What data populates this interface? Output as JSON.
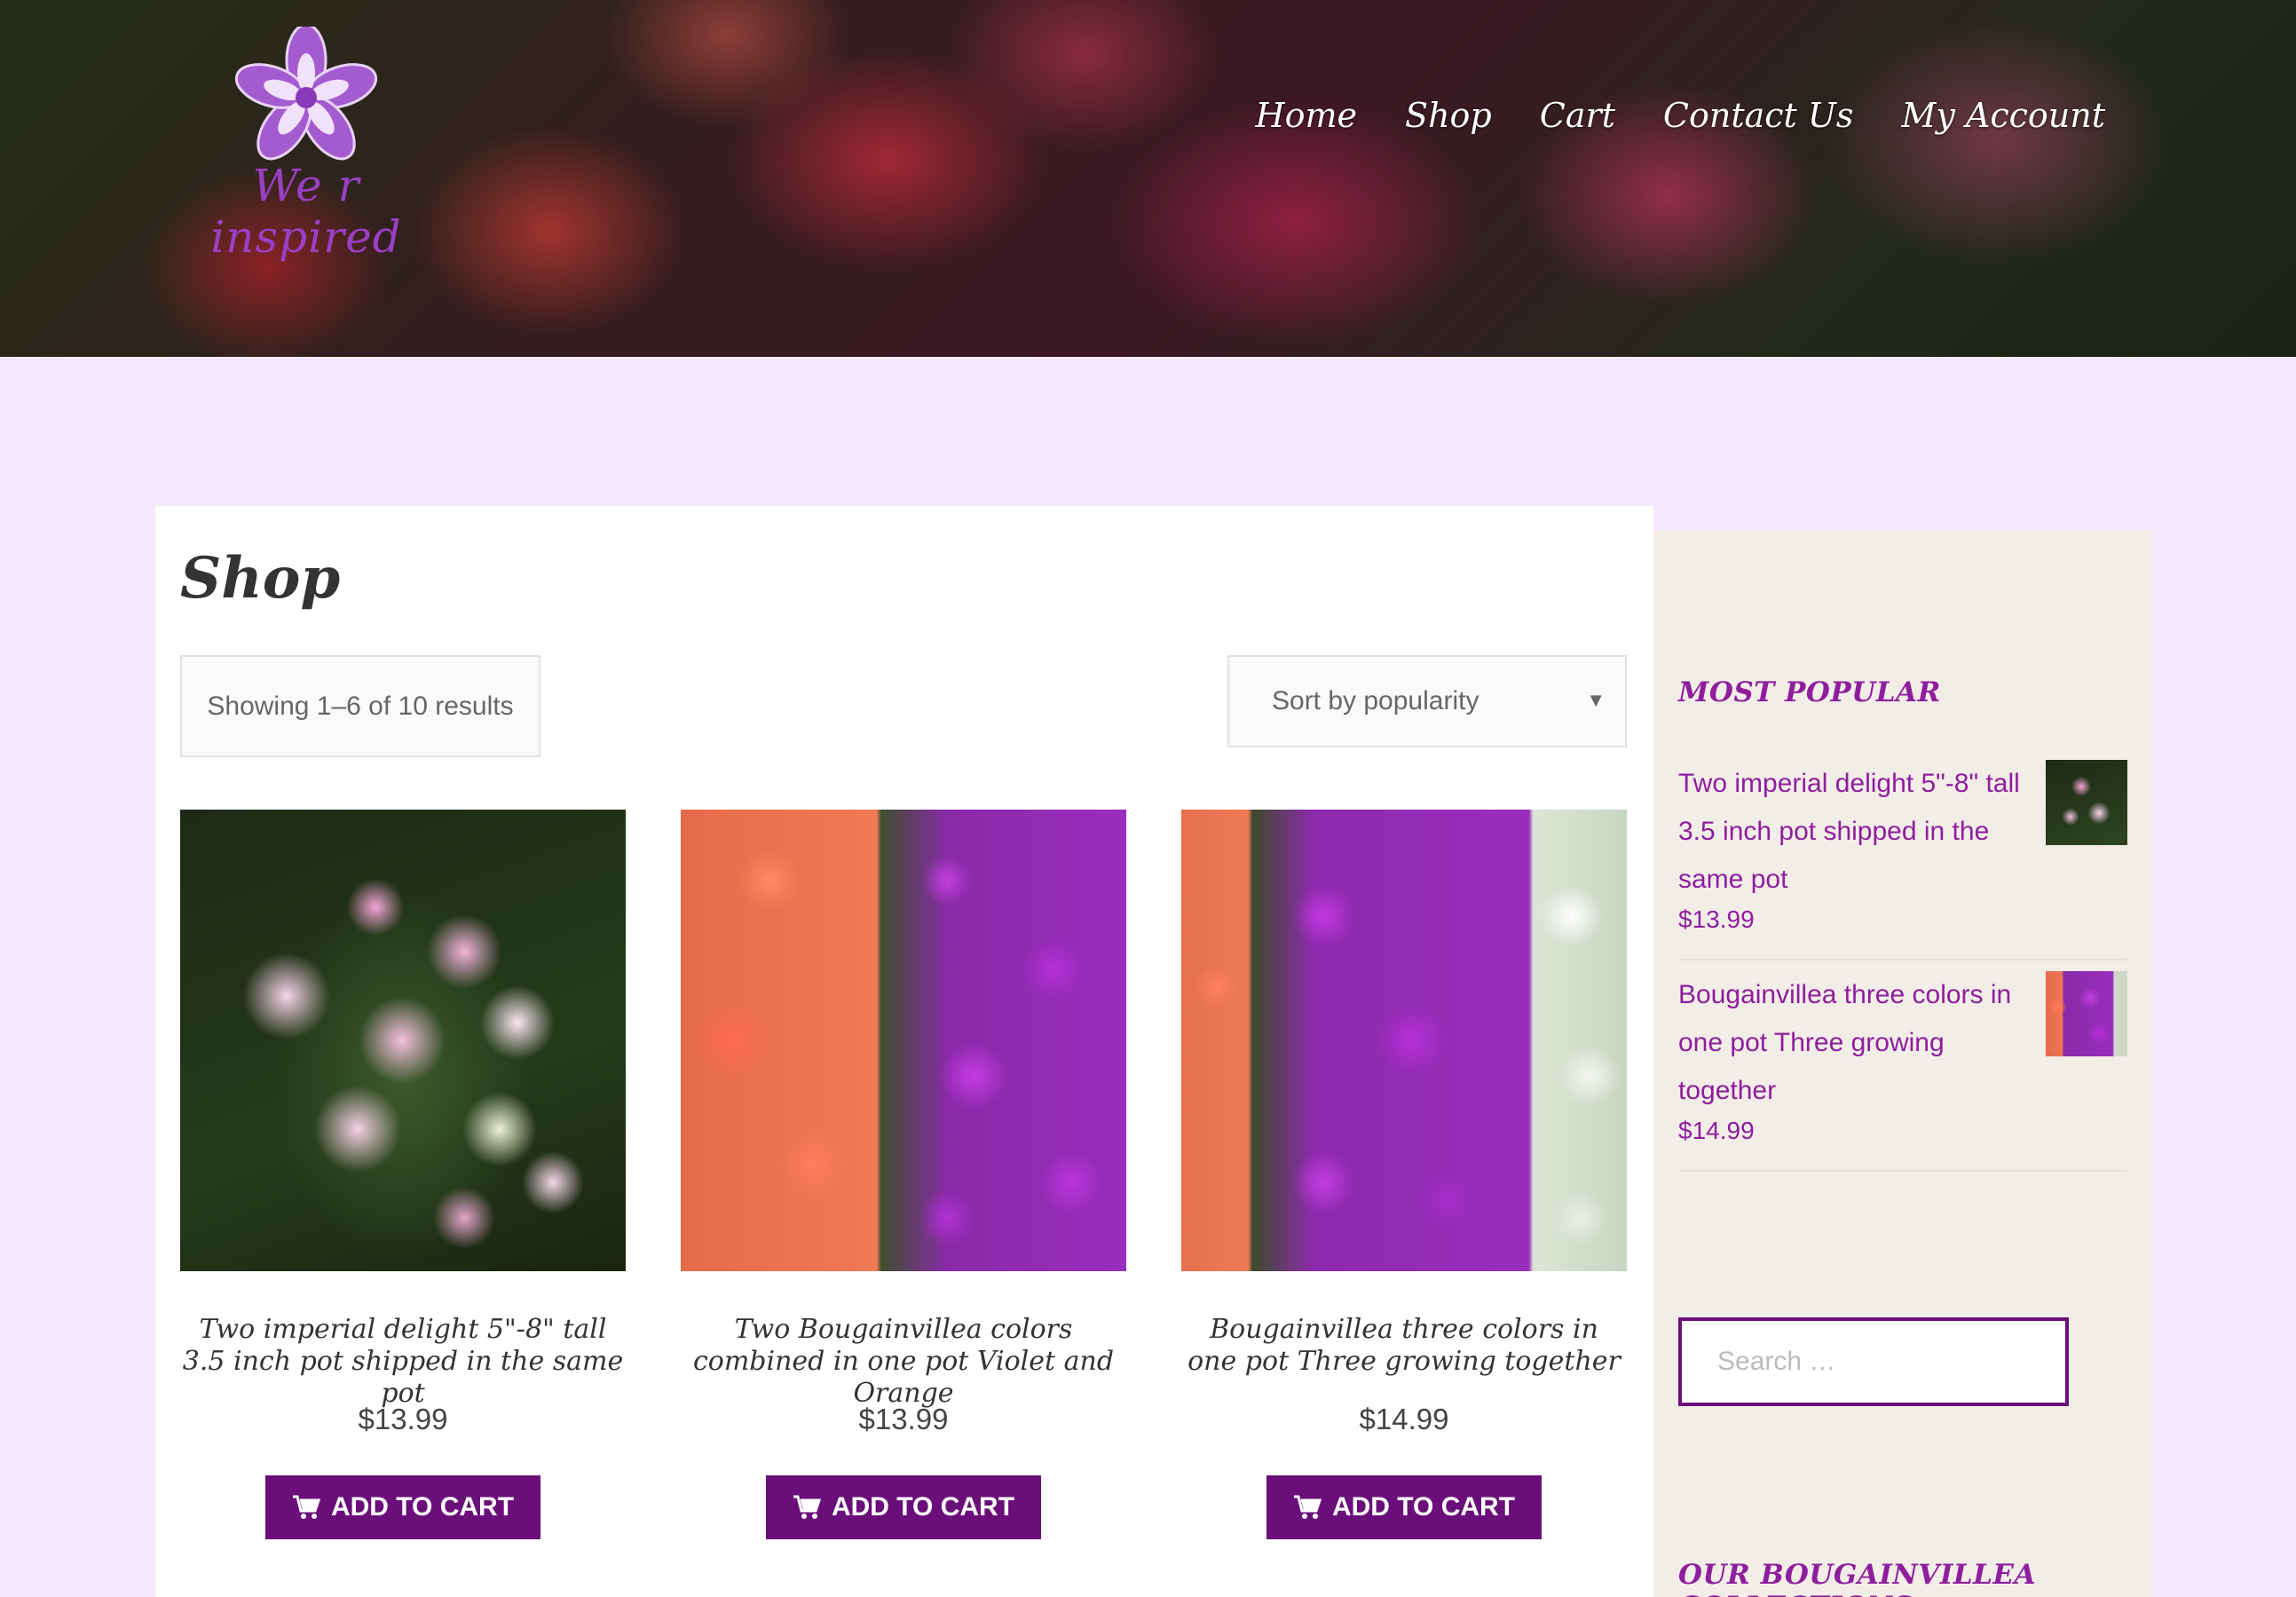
{
  "header": {
    "logo_text": "We r inspired",
    "nav": [
      "Home",
      "Shop",
      "Cart",
      "Contact Us",
      "My Account"
    ]
  },
  "main": {
    "title": "Shop",
    "result_count": "Showing 1–6 of 10 results",
    "sort_selected": "Sort by popularity",
    "products": [
      {
        "name": "Two imperial delight 5\"-8\" tall 3.5 inch pot shipped in the same pot",
        "price": "$13.99",
        "button": "ADD TO CART"
      },
      {
        "name": "Two Bougainvillea colors combined in one pot Violet and Orange",
        "price": "$13.99",
        "button": "ADD TO CART"
      },
      {
        "name": "Bougainvillea three colors in one pot Three growing together",
        "price": "$14.99",
        "button": "ADD TO CART"
      }
    ]
  },
  "sidebar": {
    "popular_title": "MOST POPULAR",
    "popular": [
      {
        "title": "Two imperial delight 5\"-8\" tall 3.5 inch pot shipped in the same pot",
        "price": "$13.99"
      },
      {
        "title": "Bougainvillea three colors in one pot Three growing together",
        "price": "$14.99"
      }
    ],
    "search_placeholder": "Search …",
    "collections_title": "OUR BOUGAINVILLEA COLLECTIONS"
  },
  "colors": {
    "accent": "#6a0f7a",
    "link": "#8e1e9e",
    "page_bg": "#f6e9fb",
    "sidebar_bg": "#f3ede7"
  }
}
